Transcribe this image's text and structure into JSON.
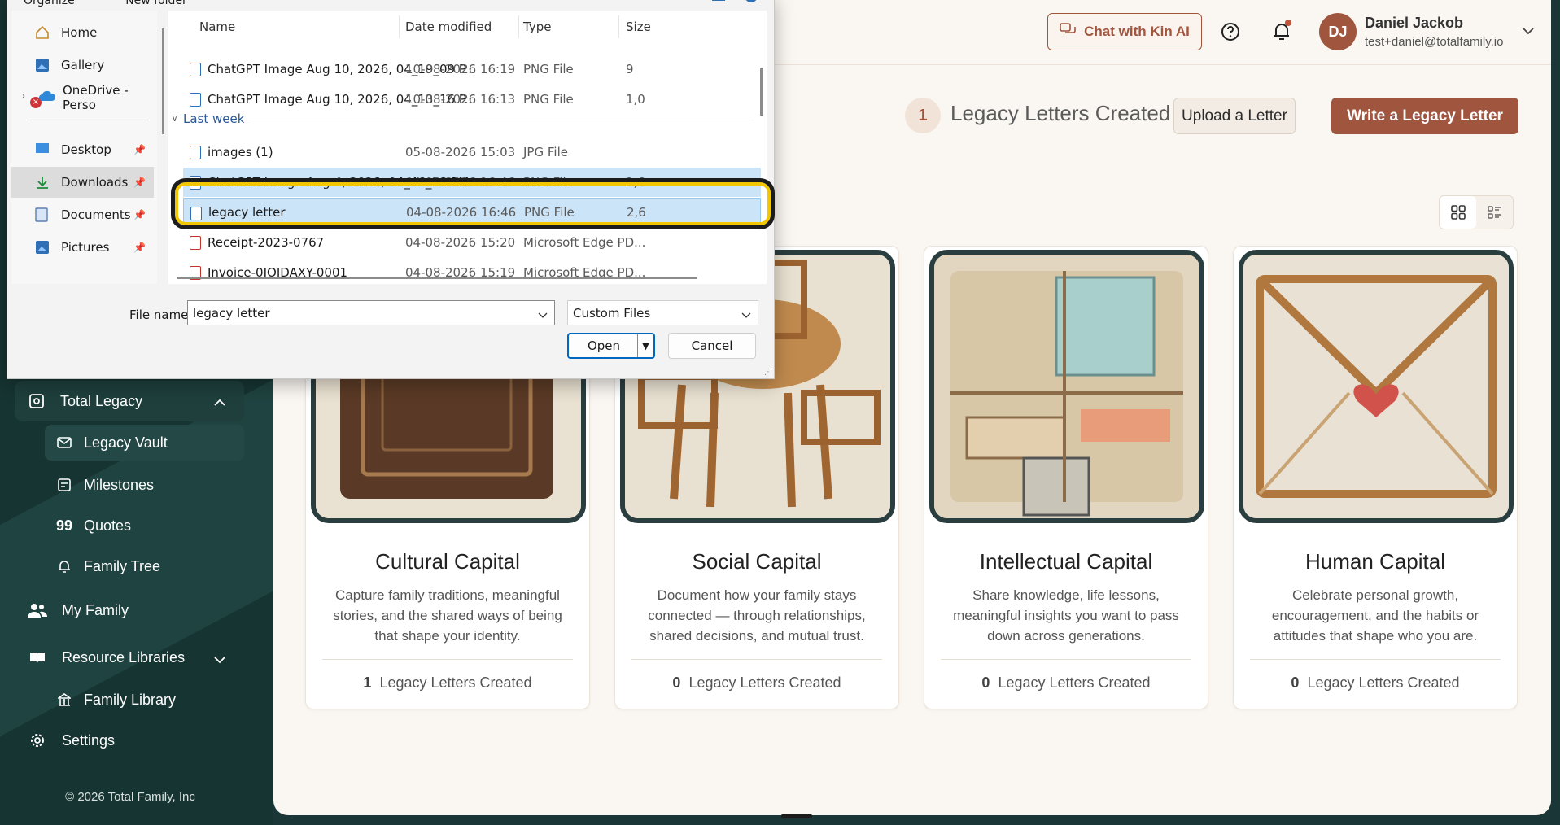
{
  "sidebar": {
    "total_legacy": "Total Legacy",
    "items": [
      {
        "label": "Legacy Vault"
      },
      {
        "label": "Milestones"
      },
      {
        "label": "Quotes"
      },
      {
        "label": "Family Tree"
      }
    ],
    "my_family": "My Family",
    "resource_libraries": "Resource Libraries",
    "family_library": "Family Library",
    "settings": "Settings",
    "copyright": "© 2026 Total Family, Inc"
  },
  "header": {
    "chat_label": "Chat with Kin AI",
    "user_initials": "DJ",
    "user_name": "Daniel Jackob",
    "user_email": "test+daniel@totalfamily.io"
  },
  "summary": {
    "count": "1",
    "label": "Legacy Letters Created",
    "upload_label": "Upload a Letter",
    "write_label": "Write a Legacy Letter"
  },
  "cards": [
    {
      "title": "Cultural Capital",
      "desc": "Capture family traditions, meaningful stories, and the shared ways of being that shape your identity.",
      "count": "1",
      "count_label": "Legacy Letters Created"
    },
    {
      "title": "Social Capital",
      "desc": "Document how your family stays connected — through relationships, shared decisions, and mutual trust.",
      "count": "0",
      "count_label": "Legacy Letters Created"
    },
    {
      "title": "Intellectual Capital",
      "desc": "Share knowledge, life lessons, meaningful insights you want to pass down across generations.",
      "count": "0",
      "count_label": "Legacy Letters Created"
    },
    {
      "title": "Human Capital",
      "desc": "Celebrate personal growth, encouragement, and the habits or attitudes that shape who you are.",
      "count": "0",
      "count_label": "Legacy Letters Created"
    }
  ],
  "dialog": {
    "toolbar": {
      "organize": "Organize",
      "new_folder": "New folder"
    },
    "nav": [
      {
        "label": "Home"
      },
      {
        "label": "Gallery"
      },
      {
        "label": "OneDrive - Perso"
      },
      {
        "label": "Desktop"
      },
      {
        "label": "Downloads"
      },
      {
        "label": "Documents"
      },
      {
        "label": "Pictures"
      }
    ],
    "columns": {
      "name": "Name",
      "date": "Date modified",
      "type": "Type",
      "size": "Size"
    },
    "group_last_week": "Last week",
    "files": [
      {
        "name": "ChatGPT Image Aug 10, 2026, 04_19_09 P...",
        "date": "10-08-2026 16:19",
        "type": "PNG File",
        "size": "9"
      },
      {
        "name": "ChatGPT Image Aug 10, 2026, 04_13_16 P...",
        "date": "10-08-2026 16:13",
        "type": "PNG File",
        "size": "1,0"
      },
      {
        "name": "images (1)",
        "date": "05-08-2026 15:03",
        "type": "JPG File",
        "size": ""
      },
      {
        "name": "ChatGPT Image Aug 4, 2026, 04_46_18 PM",
        "date": "04-08-2026 16:46",
        "type": "PNG File",
        "size": "2,6"
      },
      {
        "name": "legacy letter",
        "date": "04-08-2026 16:46",
        "type": "PNG File",
        "size": "2,6"
      },
      {
        "name": "Receipt-2023-0767",
        "date": "04-08-2026 15:20",
        "type": "Microsoft Edge PD...",
        "size": ""
      },
      {
        "name": "Invoice-0JOJDAXY-0001",
        "date": "04-08-2026 15:19",
        "type": "Microsoft Edge PD...",
        "size": ""
      }
    ],
    "file_name_label": "File name:",
    "file_name_value": "legacy letter",
    "file_type": "Custom Files",
    "open_label": "Open",
    "cancel_label": "Cancel"
  },
  "colors": {
    "accent": "#a0553e",
    "sidebar": "#163432",
    "highlight": "#f2c600"
  }
}
